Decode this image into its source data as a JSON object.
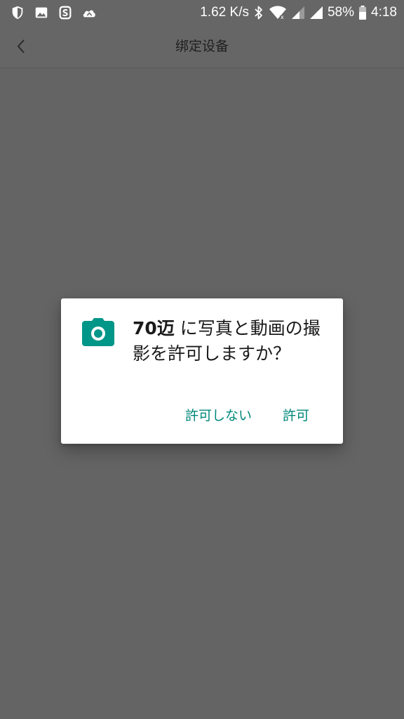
{
  "status_bar": {
    "left_icons": [
      "shield-icon",
      "gallery-icon",
      "app-notification-icon",
      "cloud-icon"
    ],
    "net_speed": "1.62 K/s",
    "battery": "58%",
    "time": "4:18",
    "right_icons": [
      "bluetooth-icon",
      "wifi-icon",
      "signal-icon",
      "signal-icon",
      "battery-icon"
    ]
  },
  "header": {
    "title": "绑定设备",
    "back_icon": "chevron-left-icon"
  },
  "dialog": {
    "icon": "camera-icon",
    "accent_color": "#009688",
    "app_name": "70迈",
    "message": " に写真と動画の撮影を許可しますか？",
    "deny_label": "許可しない",
    "allow_label": "許可"
  },
  "colors": {
    "scrim": "#646464",
    "button_text": "#00887a",
    "dialog_background": "#ffffff"
  }
}
